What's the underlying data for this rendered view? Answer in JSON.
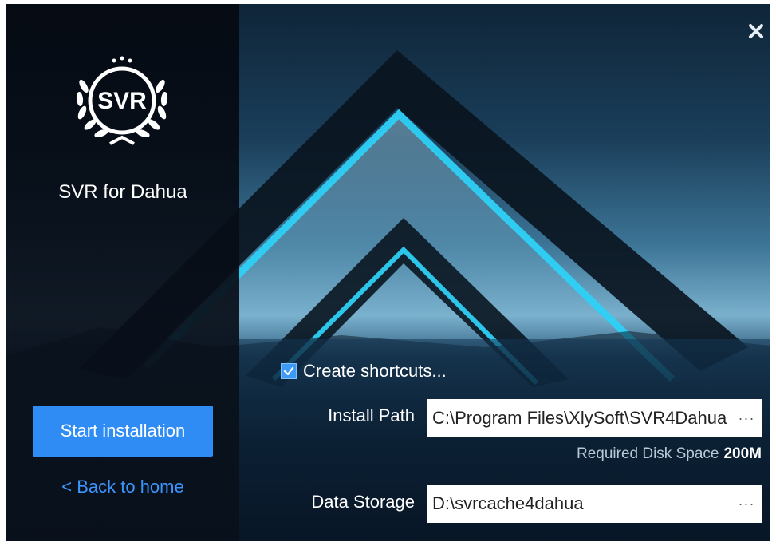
{
  "app": {
    "name": "SVR for Dahua",
    "logo_text": "SVR"
  },
  "sidebar": {
    "start_button": "Start installation",
    "back_link": "< Back to home"
  },
  "options": {
    "create_shortcuts": {
      "label": "Create shortcuts...",
      "checked": true
    },
    "install_path": {
      "label": "Install Path",
      "value": "C:\\Program Files\\XlySoft\\SVR4Dahua",
      "browse": "···"
    },
    "disk_space": {
      "label": "Required Disk Space",
      "value": "200M"
    },
    "data_storage": {
      "label": "Data Storage",
      "value": "D:\\svrcache4dahua",
      "browse": "···"
    }
  },
  "colors": {
    "accent": "#2f8cf4",
    "link": "#3b95ff",
    "neon": "#2ed0f5"
  },
  "icons": {
    "close": "close-icon",
    "check": "checkmark-icon",
    "logo": "laurel-wreath-logo"
  }
}
